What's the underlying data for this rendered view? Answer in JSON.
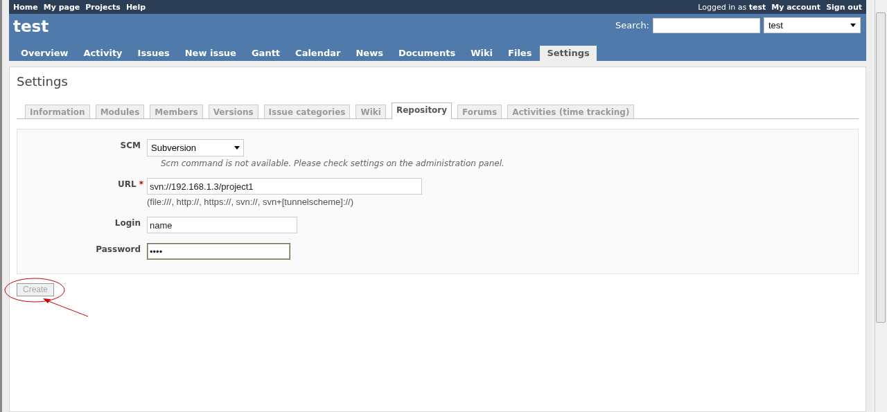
{
  "top_menu": {
    "left": [
      "Home",
      "My page",
      "Projects",
      "Help"
    ],
    "logged_in_prefix": "Logged in as",
    "user": "test",
    "right": [
      "My account",
      "Sign out"
    ]
  },
  "header": {
    "title": "test",
    "search_label": "Search:",
    "project_select": "test"
  },
  "main_tabs": [
    {
      "label": "Overview",
      "selected": false
    },
    {
      "label": "Activity",
      "selected": false
    },
    {
      "label": "Issues",
      "selected": false
    },
    {
      "label": "New issue",
      "selected": false
    },
    {
      "label": "Gantt",
      "selected": false
    },
    {
      "label": "Calendar",
      "selected": false
    },
    {
      "label": "News",
      "selected": false
    },
    {
      "label": "Documents",
      "selected": false
    },
    {
      "label": "Wiki",
      "selected": false
    },
    {
      "label": "Files",
      "selected": false
    },
    {
      "label": "Settings",
      "selected": true
    }
  ],
  "page_title": "Settings",
  "settings_tabs": [
    {
      "label": "Information",
      "selected": false
    },
    {
      "label": "Modules",
      "selected": false
    },
    {
      "label": "Members",
      "selected": false
    },
    {
      "label": "Versions",
      "selected": false
    },
    {
      "label": "Issue categories",
      "selected": false
    },
    {
      "label": "Wiki",
      "selected": false
    },
    {
      "label": "Repository",
      "selected": true
    },
    {
      "label": "Forums",
      "selected": false
    },
    {
      "label": "Activities (time tracking)",
      "selected": false
    }
  ],
  "form": {
    "fields": [
      {
        "kind": "select",
        "label": "SCM",
        "required": false,
        "value": "Subversion",
        "focused": false,
        "note": "Scm command is not available. Please check settings on the administration panel."
      },
      {
        "kind": "text",
        "label": "URL",
        "required": true,
        "value": "svn://192.168.1.3/project1",
        "focused": false,
        "note": "(file:///, http://, https://, svn://, svn+[tunnelscheme]://)"
      },
      {
        "kind": "text",
        "label": "Login",
        "required": false,
        "value": "name",
        "focused": false
      },
      {
        "kind": "password",
        "label": "Password",
        "required": false,
        "value": "••••",
        "focused": true
      }
    ],
    "required_mark": "*"
  },
  "create_button": {
    "label": "Create",
    "disabled": true
  }
}
